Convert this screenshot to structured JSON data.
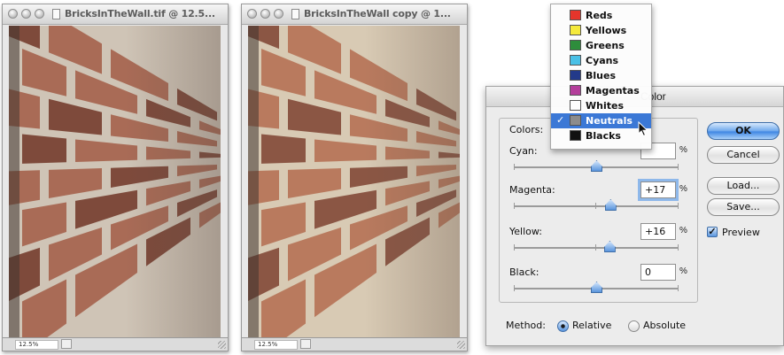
{
  "windows": [
    {
      "title": "BricksInTheWall.tif @ 12.5...",
      "zoom": "12.5%",
      "tone": {
        "brick": "#a96b56",
        "brick_dark": "#7e4a3b",
        "mortar": "#cfc4b6",
        "bg": "#5e4f47"
      }
    },
    {
      "title": "BricksInTheWall copy @ 1...",
      "zoom": "12.5%",
      "tone": {
        "brick": "#b97a5e",
        "brick_dark": "#8b5644",
        "mortar": "#d8cab4",
        "bg": "#6a574c"
      }
    }
  ],
  "dialog": {
    "title_fragment": "Color",
    "colors_label": "Colors:",
    "sliders": [
      {
        "label": "Cyan:",
        "value": "",
        "unit": "%",
        "fraction": 0.5,
        "focused": false
      },
      {
        "label": "Magenta:",
        "value": "+17",
        "unit": "%",
        "fraction": 0.585,
        "focused": true
      },
      {
        "label": "Yellow:",
        "value": "+16",
        "unit": "%",
        "fraction": 0.58,
        "focused": false
      },
      {
        "label": "Black:",
        "value": "0",
        "unit": "%",
        "fraction": 0.5,
        "focused": false
      }
    ],
    "buttons": {
      "ok": "OK",
      "cancel": "Cancel",
      "load": "Load...",
      "save": "Save..."
    },
    "preview_label": "Preview",
    "method_label": "Method:",
    "method_relative": "Relative",
    "method_absolute": "Absolute",
    "method_selected": "Relative"
  },
  "color_menu": {
    "items": [
      {
        "label": "Reds",
        "color": "#e5352b"
      },
      {
        "label": "Yellows",
        "color": "#f5ea3c"
      },
      {
        "label": "Greens",
        "color": "#2e8d3c"
      },
      {
        "label": "Cyans",
        "color": "#49c0e6"
      },
      {
        "label": "Blues",
        "color": "#233a8a"
      },
      {
        "label": "Magentas",
        "color": "#b43e9b"
      },
      {
        "label": "Whites",
        "color": "#ffffff"
      },
      {
        "label": "Neutrals",
        "color": "#8c8c8c"
      },
      {
        "label": "Blacks",
        "color": "#111111"
      }
    ],
    "selected": "Neutrals"
  },
  "colors": {
    "accent": "#3b78d6"
  }
}
